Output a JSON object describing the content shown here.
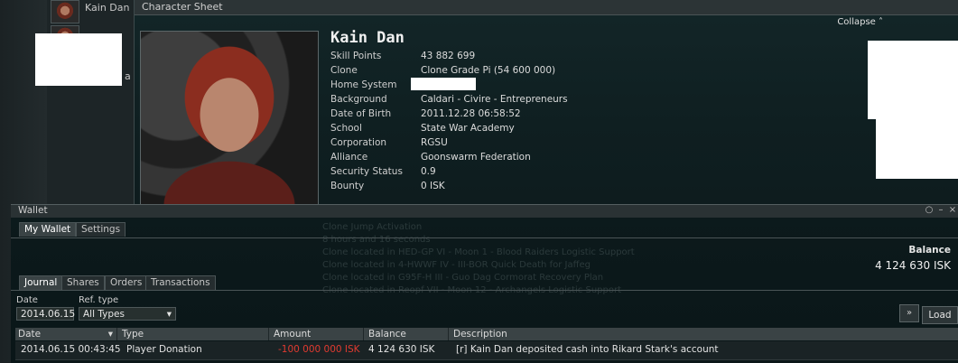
{
  "character_list": {
    "entries": [
      {
        "name": "Kain Dan"
      },
      {
        "name": "a"
      }
    ]
  },
  "character_sheet": {
    "window_title": "Character Sheet",
    "collapse_label": "Collapse",
    "name": "Kain Dan",
    "fields": [
      {
        "label": "Skill Points",
        "value": "43 882 699"
      },
      {
        "label": "Clone",
        "value": "Clone Grade Pi (54 600 000)"
      },
      {
        "label": "Home System",
        "value": ""
      },
      {
        "label": "Background",
        "value": "Caldari - Civire - Entrepreneurs"
      },
      {
        "label": "Date of Birth",
        "value": "2011.12.28 06:58:52"
      },
      {
        "label": "School",
        "value": "State War Academy"
      },
      {
        "label": "Corporation",
        "value": "RGSU"
      },
      {
        "label": "Alliance",
        "value": "Goonswarm Federation"
      },
      {
        "label": "Security Status",
        "value": "0.9"
      },
      {
        "label": "Bounty",
        "value": "0 ISK"
      }
    ]
  },
  "wallet": {
    "window_title": "Wallet",
    "tabs": [
      "My Wallet",
      "Settings"
    ],
    "balance_label": "Balance",
    "balance_value": "4 124 630 ISK",
    "sub_tabs": [
      "Journal",
      "Shares",
      "Orders",
      "Transactions"
    ],
    "filters": {
      "date_label": "Date",
      "date_value": "2014.06.15",
      "ref_type_label": "Ref. type",
      "ref_type_value": "All Types"
    },
    "load_label": "Load",
    "columns": [
      "Date",
      "Type",
      "Amount",
      "Balance",
      "Description"
    ],
    "rows": [
      {
        "date": "2014.06.15 00:43:45",
        "type": "Player Donation",
        "amount": "-100 000 000 ISK",
        "balance": "4 124 630 ISK",
        "description": "[r] Kain Dan deposited cash into Rikard Stark's account"
      }
    ]
  },
  "background_text": [
    "Clone Jump Activation",
    "8 hours and 16 seconds",
    "Clone located in HED-GP VI - Moon 1 - Blood Raiders Logistic Support",
    "Clone located in 4-HWWF IV - III-BOR Quick Death for Jaffeg",
    "Clone located in G95F-H III - Guo Dag Cormorat Recovery Plan",
    "Clone located in Reopf VII - Moon 12 - Archangels Logistic Support"
  ],
  "colors": {
    "negative_amount": "#e03a30",
    "panel_bg": "#0f1f21",
    "header_bg": "#3a4345"
  }
}
